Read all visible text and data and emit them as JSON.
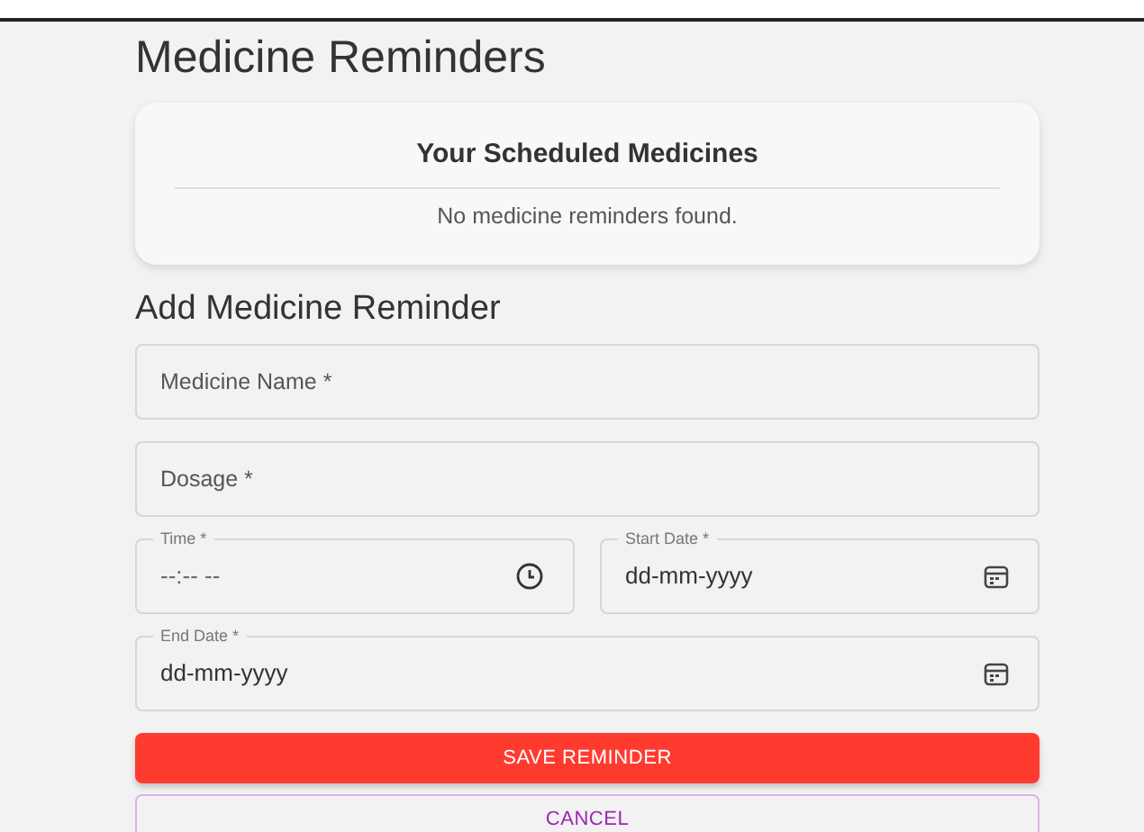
{
  "page_title": "Medicine Reminders",
  "scheduled": {
    "title": "Your Scheduled Medicines",
    "empty_message": "No medicine reminders found."
  },
  "form": {
    "title": "Add Medicine Reminder",
    "fields": [
      {
        "kind": "text",
        "label": "Medicine Name *"
      },
      {
        "kind": "text",
        "label": "Dosage *"
      },
      {
        "kind": "time",
        "label": "Time *",
        "value": "--:-- --"
      },
      {
        "kind": "date",
        "label": "Start Date *",
        "value": "dd-mm-yyyy"
      },
      {
        "kind": "date",
        "label": "End Date *",
        "value": "dd-mm-yyyy"
      }
    ],
    "buttons": [
      {
        "kind": "primary",
        "label": "SAVE REMINDER"
      },
      {
        "kind": "outlined",
        "label": "CANCEL"
      }
    ]
  }
}
